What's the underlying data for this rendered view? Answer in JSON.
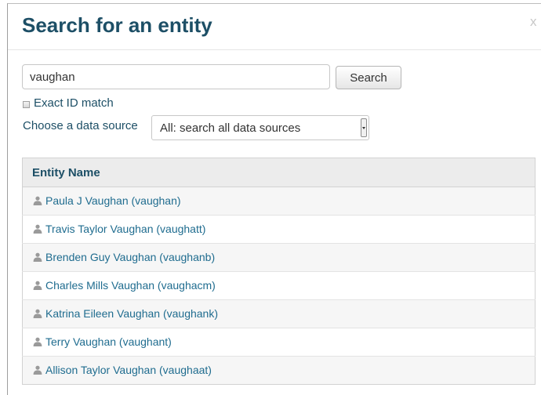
{
  "dialog": {
    "title": "Search for an entity",
    "close_label": "x"
  },
  "search": {
    "value": "vaughan",
    "button_label": "Search"
  },
  "exact_match": {
    "label": "Exact ID match",
    "checked": false
  },
  "data_source": {
    "label": "Choose a data source",
    "selected": "All: search all data sources"
  },
  "results": {
    "column_header": "Entity Name",
    "rows": [
      {
        "name": "Paula J Vaughan (vaughan)",
        "icon": "user-icon"
      },
      {
        "name": "Travis Taylor Vaughan (vaughatt)",
        "icon": "user-icon"
      },
      {
        "name": "Brenden Guy Vaughan (vaughanb)",
        "icon": "user-icon"
      },
      {
        "name": "Charles Mills Vaughan (vaughacm)",
        "icon": "user-icon"
      },
      {
        "name": "Katrina Eileen Vaughan (vaughank)",
        "icon": "user-icon"
      },
      {
        "name": "Terry Vaughan (vaughant)",
        "icon": "user-icon"
      },
      {
        "name": "Allison Taylor Vaughan (vaughaat)",
        "icon": "user-icon"
      }
    ]
  },
  "colors": {
    "title": "#1d4f66",
    "link": "#1f6c8f",
    "header_bg": "#ececec",
    "row_alt_bg": "#f6f6f6",
    "icon": "#9a9a9a"
  }
}
